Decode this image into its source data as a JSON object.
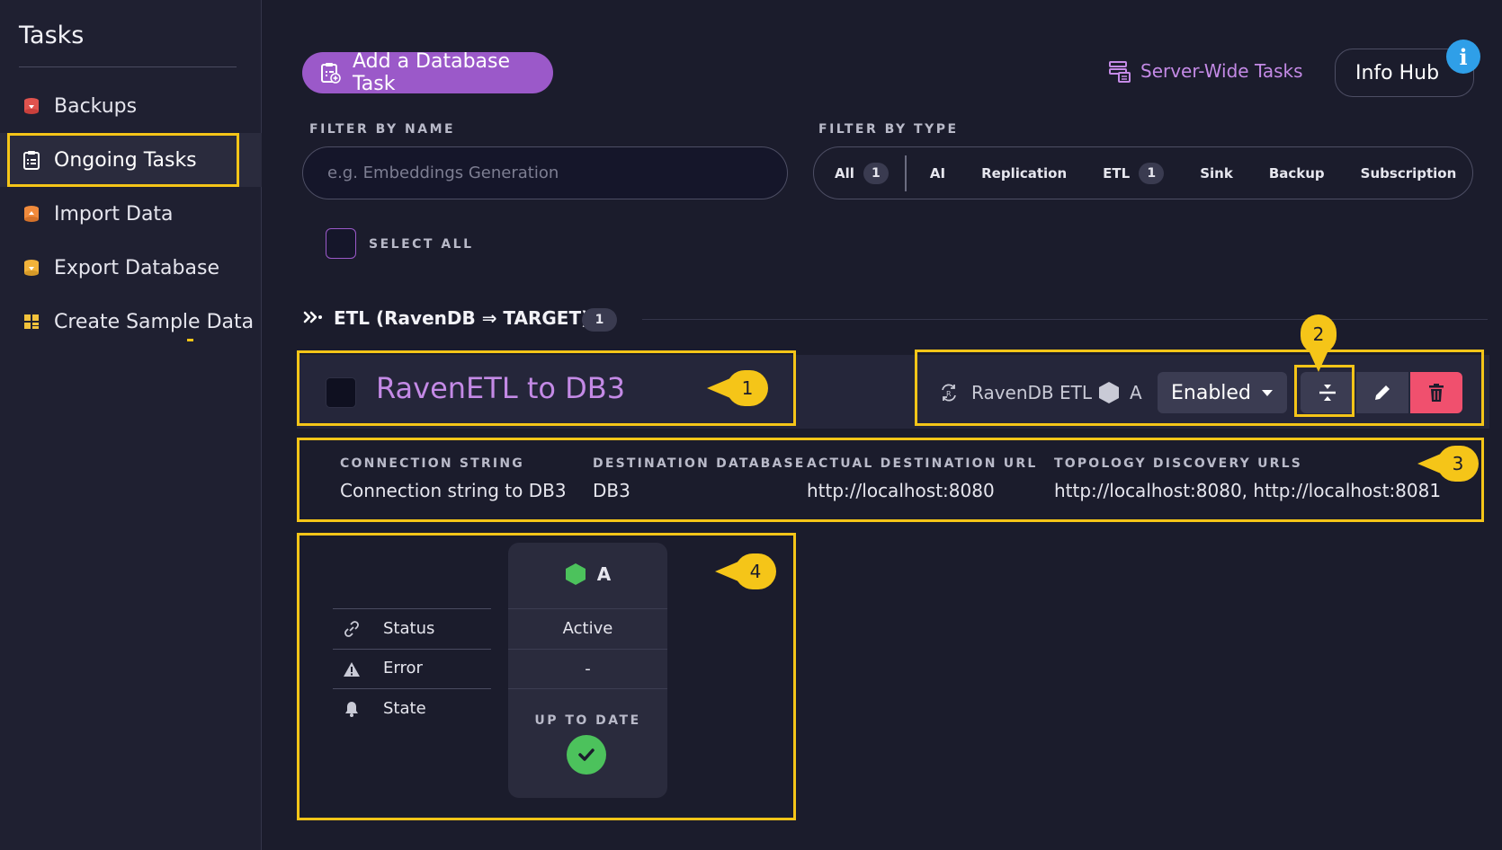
{
  "sidebar": {
    "title": "Tasks",
    "items": [
      {
        "label": "Backups",
        "icon": "backup-icon"
      },
      {
        "label": "Ongoing Tasks",
        "icon": "clipboard-icon"
      },
      {
        "label": "Import Data",
        "icon": "import-icon"
      },
      {
        "label": "Export Database",
        "icon": "export-icon"
      },
      {
        "label": "Create Sample Data",
        "icon": "sample-data-icon"
      }
    ]
  },
  "toolbar": {
    "add_task_label": "Add a Database Task",
    "server_wide_label": "Server-Wide Tasks",
    "info_hub_label": "Info Hub",
    "info_badge": "i"
  },
  "filters": {
    "by_name_label": "FILTER BY NAME",
    "name_placeholder": "e.g. Embeddings Generation",
    "by_type_label": "FILTER BY TYPE",
    "types": [
      {
        "label": "All",
        "count": "1"
      },
      {
        "label": "AI"
      },
      {
        "label": "Replication"
      },
      {
        "label": "ETL",
        "count": "1"
      },
      {
        "label": "Sink"
      },
      {
        "label": "Backup"
      },
      {
        "label": "Subscription"
      }
    ],
    "select_all_label": "SELECT ALL"
  },
  "section": {
    "title": "ETL (RavenDB ⇒ TARGET)",
    "count": "1"
  },
  "task": {
    "name": "RavenETL to DB3",
    "type_label": "RavenDB ETL",
    "node": "A",
    "state_button": "Enabled",
    "details": [
      {
        "key": "CONNECTION STRING",
        "value": "Connection string to DB3"
      },
      {
        "key": "DESTINATION DATABASE",
        "value": "DB3"
      },
      {
        "key": "ACTUAL DESTINATION URL",
        "value": "http://localhost:8080"
      },
      {
        "key": "TOPOLOGY DISCOVERY URLS",
        "value": "http://localhost:8080, http://localhost:8081"
      }
    ],
    "status_rows": [
      {
        "label": "Status",
        "icon": "link-icon",
        "value": "Active"
      },
      {
        "label": "Error",
        "icon": "warning-icon",
        "value": "-"
      },
      {
        "label": "State",
        "icon": "bell-icon",
        "value": "UP TO DATE"
      }
    ]
  },
  "callouts": [
    "1",
    "2",
    "3",
    "4"
  ],
  "colors": {
    "background": "#1b1c2c",
    "accent_purple": "#9b59c9",
    "highlight_yellow": "#f5c518",
    "delete_red": "#f0506e",
    "success_green": "#4cc25c"
  }
}
